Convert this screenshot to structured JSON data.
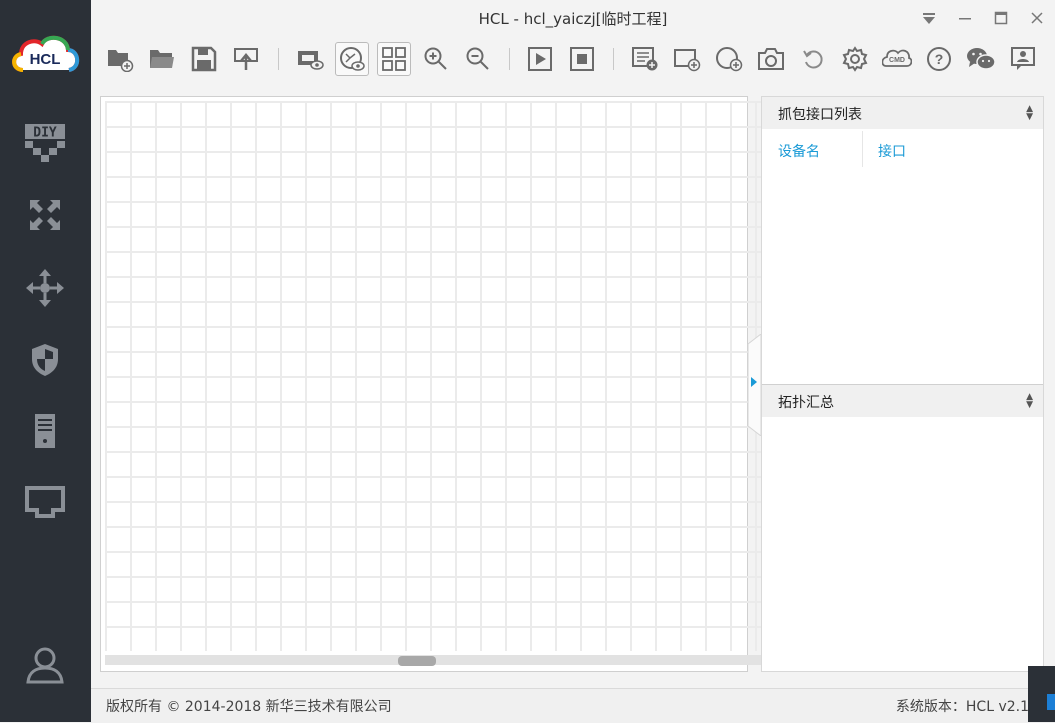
{
  "window": {
    "title": "HCL - hcl_yaiczj[临时工程]"
  },
  "sidebar": {
    "logo_text": "HCL",
    "items": [
      {
        "icon": "diy-icon"
      },
      {
        "icon": "router-icon"
      },
      {
        "icon": "switch-icon"
      },
      {
        "icon": "firewall-icon"
      },
      {
        "icon": "server-icon"
      },
      {
        "icon": "network-icon"
      },
      {
        "icon": "user-icon"
      }
    ]
  },
  "toolbar": {
    "buttons": [
      "new-project-icon",
      "open-project-icon",
      "save-icon",
      "export-icon",
      "show-interface-icon",
      "show-topology-icon",
      "grid-icon",
      "zoom-in-icon",
      "zoom-out-icon",
      "start-all-icon",
      "stop-all-icon",
      "capture-list-icon",
      "add-rectangle-icon",
      "add-ellipse-icon",
      "screenshot-icon",
      "undo-icon",
      "settings-icon",
      "cmd-icon",
      "help-icon",
      "wechat-icon",
      "feedback-icon"
    ],
    "cmd_label": "CMD"
  },
  "right_panel": {
    "capture_title": "抓包接口列表",
    "col_device": "设备名",
    "col_interface": "接口",
    "topology_title": "拓扑汇总"
  },
  "footer": {
    "copyright": "版权所有 © 2014-2018 新华三技术有限公司",
    "version": "系统版本：HCL v2.1"
  },
  "colors": {
    "sidebar_bg": "#2b3037",
    "accent_blue": "#1a9ad6",
    "icon_gray": "#6a6a6a"
  }
}
